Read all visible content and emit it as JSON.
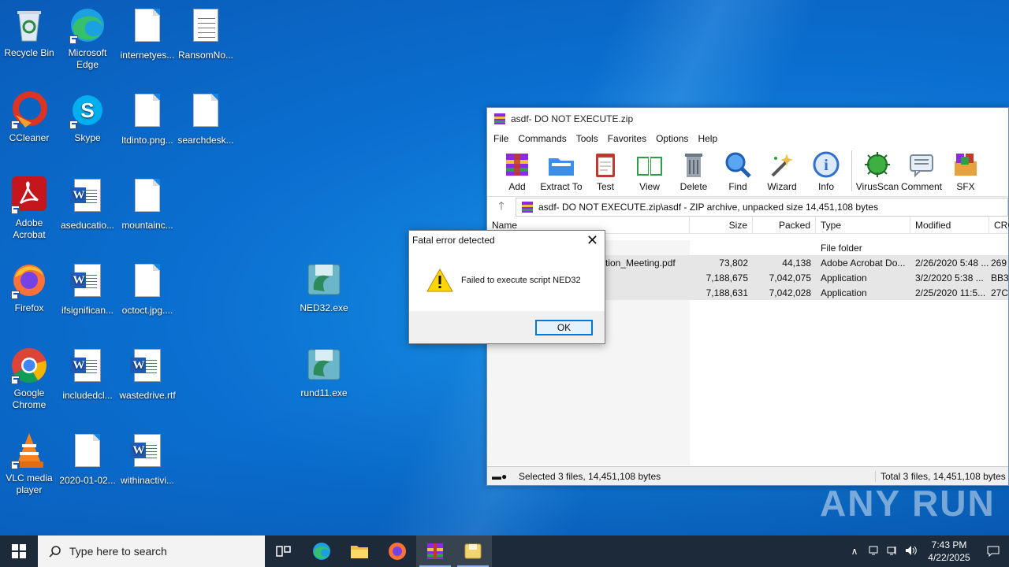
{
  "desktop": {
    "icons": [
      {
        "label": "Recycle Bin"
      },
      {
        "label": "Microsoft Edge"
      },
      {
        "label": "internetyes..."
      },
      {
        "label": "RansomNo..."
      },
      {
        "label": "CCleaner"
      },
      {
        "label": "Skype"
      },
      {
        "label": "ltdinto.png..."
      },
      {
        "label": "searchdesk..."
      },
      {
        "label": "Adobe Acrobat"
      },
      {
        "label": "aseducatio..."
      },
      {
        "label": "mountainc..."
      },
      {
        "label": "Firefox"
      },
      {
        "label": "ifsignifican..."
      },
      {
        "label": "octoct.jpg...."
      },
      {
        "label": "NED32.exe"
      },
      {
        "label": "Google Chrome"
      },
      {
        "label": "includedcl..."
      },
      {
        "label": "wastedrive.rtf"
      },
      {
        "label": "rund11.exe"
      },
      {
        "label": "VLC media player"
      },
      {
        "label": "2020-01-02..."
      },
      {
        "label": "withinactivi..."
      }
    ]
  },
  "winrar": {
    "title": "asdf- DO NOT EXECUTE.zip",
    "menu": [
      "File",
      "Commands",
      "Tools",
      "Favorites",
      "Options",
      "Help"
    ],
    "toolbar": [
      "Add",
      "Extract To",
      "Test",
      "View",
      "Delete",
      "Find",
      "Wizard",
      "Info",
      "VirusScan",
      "Comment",
      "SFX"
    ],
    "address": "asdf- DO NOT EXECUTE.zip\\asdf - ZIP archive, unpacked size 14,451,108 bytes",
    "columns": [
      "Name",
      "Size",
      "Packed",
      "Type",
      "Modified",
      "CRC"
    ],
    "rows": [
      {
        "name": "",
        "size": "",
        "packed": "",
        "type": "File folder",
        "modified": "",
        "crc": ""
      },
      {
        "name": "tion_Meeting.pdf",
        "size": "73,802",
        "packed": "44,138",
        "type": "Adobe Acrobat Do...",
        "modified": "2/26/2020 5:48 ...",
        "crc": "269"
      },
      {
        "name": "",
        "size": "7,188,675",
        "packed": "7,042,075",
        "type": "Application",
        "modified": "3/2/2020 5:38 ...",
        "crc": "BB3"
      },
      {
        "name": "",
        "size": "7,188,631",
        "packed": "7,042,028",
        "type": "Application",
        "modified": "2/25/2020 11:5...",
        "crc": "27C"
      }
    ],
    "status_left": "Selected 3 files, 14,451,108 bytes",
    "status_right": "Total 3 files, 14,451,108 bytes"
  },
  "dialog": {
    "title": "Fatal error detected",
    "message": "Failed to execute script NED32",
    "ok_label": "OK"
  },
  "taskbar": {
    "search_placeholder": "Type here to search",
    "time": "7:43 PM",
    "date": "4/22/2025"
  },
  "watermark": "ANY RUN"
}
